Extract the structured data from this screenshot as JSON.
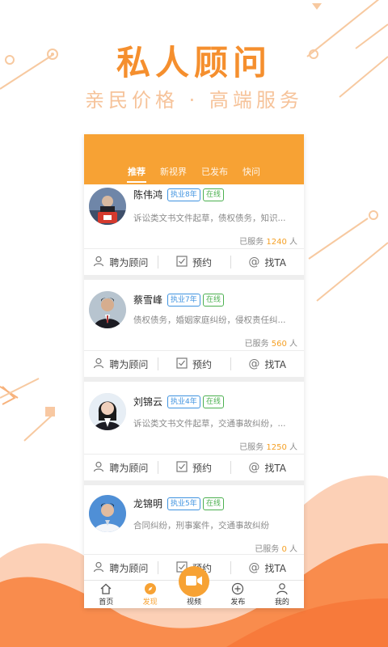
{
  "promo": {
    "headline": "私人顾问",
    "subline": "亲民价格 · 高端服务"
  },
  "tabs": [
    {
      "label": "推荐",
      "active": true
    },
    {
      "label": "新视界",
      "active": false
    },
    {
      "label": "已发布",
      "active": false
    },
    {
      "label": "快问",
      "active": false
    }
  ],
  "advisors": [
    {
      "name": "陈伟鸿",
      "years": "执业8年",
      "status": "在线",
      "desc": "诉讼类文书文件起草，债权债务，知识...",
      "served_prefix": "已服务",
      "served_count": "1240",
      "served_suffix": "人"
    },
    {
      "name": "蔡雪峰",
      "years": "执业7年",
      "status": "在线",
      "desc": "债权债务，婚姻家庭纠纷，侵权责任纠...",
      "served_prefix": "已服务",
      "served_count": "560",
      "served_suffix": "人"
    },
    {
      "name": "刘锦云",
      "years": "执业4年",
      "status": "在线",
      "desc": "诉讼类文书文件起草，交通事故纠纷，...",
      "served_prefix": "已服务",
      "served_count": "1250",
      "served_suffix": "人"
    },
    {
      "name": "龙锦明",
      "years": "执业5年",
      "status": "在线",
      "desc": "合同纠纷，刑事案件，交通事故纠纷",
      "served_prefix": "已服务",
      "served_count": "0",
      "served_suffix": "人"
    }
  ],
  "actions": {
    "hire": "聘为顾问",
    "book": "预约",
    "find": "找TA"
  },
  "bottom_nav": [
    {
      "label": "首页",
      "icon": "home-icon"
    },
    {
      "label": "发现",
      "icon": "compass-icon",
      "active": true
    },
    {
      "label": "视频",
      "icon": "video-icon"
    },
    {
      "label": "发布",
      "icon": "plus-circle-icon"
    },
    {
      "label": "我的",
      "icon": "user-icon"
    }
  ],
  "colors": {
    "accent": "#f7a234",
    "headline": "#f58f2e",
    "years_badge": "#3f93e0",
    "online_badge": "#4cb050"
  }
}
